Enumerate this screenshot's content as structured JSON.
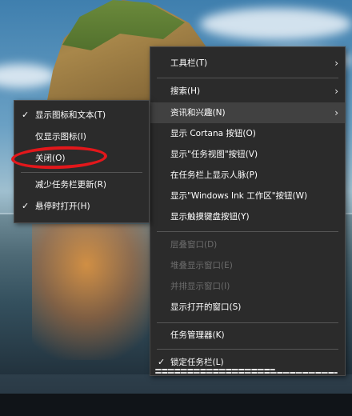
{
  "main_menu": {
    "items": [
      {
        "label": "工具栏(T)"
      },
      {
        "label": "搜索(H)"
      },
      {
        "label": "资讯和兴趣(N)"
      },
      {
        "label": "显示 Cortana 按钮(O)"
      },
      {
        "label": "显示\"任务视图\"按钮(V)"
      },
      {
        "label": "在任务栏上显示人脉(P)"
      },
      {
        "label": "显示\"Windows Ink 工作区\"按钮(W)"
      },
      {
        "label": "显示触摸键盘按钮(Y)"
      },
      {
        "label": "层叠窗口(D)"
      },
      {
        "label": "堆叠显示窗口(E)"
      },
      {
        "label": "并排显示窗口(I)"
      },
      {
        "label": "显示打开的窗口(S)"
      },
      {
        "label": "任务管理器(K)"
      },
      {
        "label": "锁定任务栏(L)"
      }
    ]
  },
  "sub_menu": {
    "items": [
      {
        "label": "显示图标和文本(T)"
      },
      {
        "label": "仅显示图标(I)"
      },
      {
        "label": "关闭(O)"
      },
      {
        "label": "减少任务栏更新(R)"
      },
      {
        "label": "悬停时打开(H)"
      }
    ]
  },
  "glyphs": {
    "check": "✓",
    "arrow": "›"
  },
  "colors": {
    "menu_bg": "#2b2b2b",
    "highlight": "#414141",
    "disabled": "#6c6c6c",
    "annotation": "#e3171b"
  }
}
